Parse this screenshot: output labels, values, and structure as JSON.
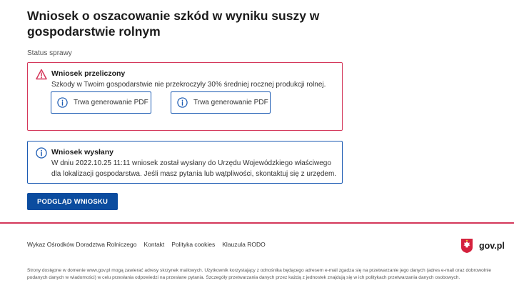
{
  "page": {
    "title": "Wniosek o oszacowanie szkód w wyniku suszy w gospodarstwie rolnym",
    "status_label": "Status sprawy"
  },
  "alerts": {
    "error": {
      "heading": "Wniosek przeliczony",
      "text": "Szkody w Twoim gospodarstwie nie przekroczyły 30% średniej rocznej produkcji rolnej.",
      "buttons": [
        {
          "label": "Trwa generowanie PDF"
        },
        {
          "label": "Trwa generowanie PDF"
        }
      ]
    },
    "info": {
      "heading": "Wniosek wysłany",
      "text": "W dniu 2022.10.25 11:11 wniosek został wysłany do Urzędu Wojewódzkiego właściwego dla lokalizacji gospodarstwa. Jeśli masz pytania lub wątpliwości, skontaktuj się z urzędem."
    }
  },
  "actions": {
    "preview_label": "PODGLĄD WNIOSKU"
  },
  "footer": {
    "links": [
      "Wykaz Ośrodków Doradztwa Rolniczego",
      "Kontakt",
      "Polityka cookies",
      "Klauzula RODO"
    ],
    "brand": "gov.pl",
    "disclaimer": "Strony dostępne w domenie www.gov.pl mogą zawierać adresy skrzynek mailowych. Użytkownik korzystający z odnośnika będącego adresem e-mail zgadza się na przetwarzanie jego danych (adres e-mail oraz dobrowolnie podanych danych w wiadomości) w celu przesłania odpowiedzi na przesłane pytania. Szczegóły przetwarzania danych przez każdą z jednostek znajdują się w ich politykach przetwarzania danych osobowych."
  },
  "colors": {
    "error": "#d4375a",
    "info": "#1c5bb3",
    "primary": "#0b4c9f"
  },
  "icons": {
    "error": "warning-triangle-icon",
    "info": "info-circle-icon",
    "emblem": "polish-emblem-icon"
  }
}
